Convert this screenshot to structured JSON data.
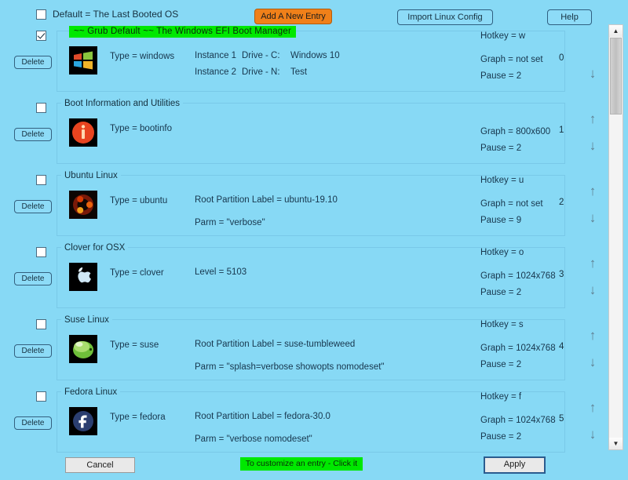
{
  "toolbar": {
    "default_checkbox_label": "Default = The Last Booted OS",
    "default_checkbox_checked": false,
    "add_entry_label": "Add A New Entry",
    "import_label": "Import Linux Config",
    "help_label": "Help"
  },
  "colors": {
    "background": "#87d9f5",
    "accent_orange": "#f08019",
    "highlight_green": "#00e800",
    "text": "#17364d",
    "panel_border": "#79c9e8"
  },
  "labels": {
    "delete": "Delete",
    "arrow_up": "↑",
    "arrow_down": "↓",
    "scroll_up": "▲",
    "scroll_down": "▼"
  },
  "entries": [
    {
      "index": "0",
      "checked": true,
      "title": "~~ Grub Default ~~         The Windows EFI Boot Manager",
      "title_highlight": true,
      "icon": "windows-logo-icon",
      "type": "Type = windows",
      "instances": [
        {
          "instance": "Instance 1",
          "drive": "Drive - C:",
          "name": "Windows 10"
        },
        {
          "instance": "Instance 2",
          "drive": "Drive - N:",
          "name": "Test"
        }
      ],
      "mid_lines": [],
      "hotkey": "Hotkey = w",
      "graph": "Graph = not set",
      "pause": "Pause = 2",
      "has_up_arrow": false,
      "has_down_arrow": true
    },
    {
      "index": "1",
      "checked": false,
      "title": "Boot Information and Utilities",
      "title_highlight": false,
      "icon": "info-circle-icon",
      "type": "Type = bootinfo",
      "instances": [],
      "mid_lines": [],
      "hotkey": "",
      "graph": "Graph = 800x600",
      "pause": "Pause = 2",
      "has_up_arrow": true,
      "has_down_arrow": true
    },
    {
      "index": "2",
      "checked": false,
      "title": "Ubuntu Linux",
      "title_highlight": false,
      "icon": "ubuntu-logo-icon",
      "type": "Type = ubuntu",
      "instances": [],
      "mid_lines": [
        "Root Partition Label = ubuntu-19.10",
        "Parm =   \"verbose\""
      ],
      "hotkey": "Hotkey = u",
      "graph": "Graph = not set",
      "pause": "Pause = 9",
      "has_up_arrow": true,
      "has_down_arrow": true
    },
    {
      "index": "3",
      "checked": false,
      "title": "Clover for OSX",
      "title_highlight": false,
      "icon": "apple-logo-icon",
      "type": "Type = clover",
      "instances": [],
      "mid_lines": [
        "Level = 5103"
      ],
      "hotkey": "Hotkey = o",
      "graph": "Graph = 1024x768",
      "pause": "Pause = 2",
      "has_up_arrow": true,
      "has_down_arrow": true
    },
    {
      "index": "4",
      "checked": false,
      "title": "Suse Linux",
      "title_highlight": false,
      "icon": "suse-logo-icon",
      "type": "Type = suse",
      "instances": [],
      "mid_lines": [
        "Root Partition Label = suse-tumbleweed",
        "Parm =   \"splash=verbose showopts nomodeset\""
      ],
      "hotkey": "Hotkey = s",
      "graph": "Graph = 1024x768",
      "pause": "Pause = 2",
      "has_up_arrow": true,
      "has_down_arrow": true
    },
    {
      "index": "5",
      "checked": false,
      "title": "Fedora Linux",
      "title_highlight": false,
      "icon": "fedora-logo-icon",
      "type": "Type = fedora",
      "instances": [],
      "mid_lines": [
        "Root Partition Label = fedora-30.0",
        "Parm =   \"verbose nomodeset\""
      ],
      "hotkey": "Hotkey = f",
      "graph": "Graph = 1024x768",
      "pause": "Pause = 2",
      "has_up_arrow": true,
      "has_down_arrow": true
    }
  ],
  "bottombar": {
    "cancel_label": "Cancel",
    "hint_label": "To customize an entry - Click it",
    "apply_label": "Apply"
  }
}
